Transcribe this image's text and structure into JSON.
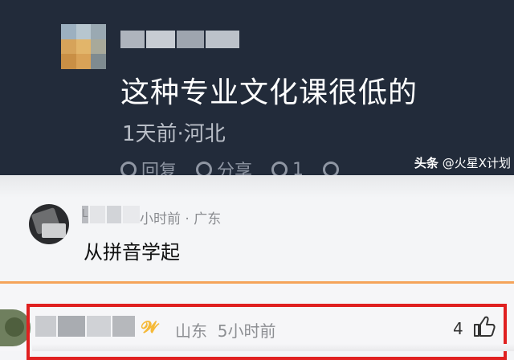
{
  "top_comment": {
    "text": "这种专业文化课很低的",
    "meta": "1天前·河北",
    "actions": {
      "reply": "回复",
      "share": "分享",
      "likes": "1"
    }
  },
  "watermark": {
    "brand": "头条",
    "account": "@火星X计划"
  },
  "comment_1": {
    "name_visible": "L",
    "time_location": "小时前 · 广东",
    "text": "从拼音学起"
  },
  "comment_2": {
    "location": "山东",
    "time": "5小时前",
    "likes": "4"
  },
  "colors": {
    "dark_bg": "#222b3a",
    "highlight_box": "#e02020",
    "divider": "#f5a45a",
    "badge": "#f5b938"
  }
}
